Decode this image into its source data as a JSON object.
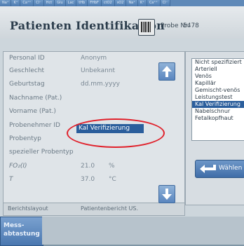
{
  "top_tabs": [
    "Na⁺",
    "K⁺",
    "Ca⁺⁺",
    "Cl⁻",
    "Hct",
    "Glu",
    "Lac",
    "tHb",
    "FHbF",
    "ctO2",
    "sO2",
    "Na⁺",
    "K⁺",
    "Ca⁺⁺",
    "Cl⁻"
  ],
  "header": {
    "title": "Patienten Identifikation",
    "probe_label": "Probe Nr.",
    "probe_value": "5478"
  },
  "fields": [
    {
      "label": "Personal ID",
      "value": "Anonym",
      "unit": ""
    },
    {
      "label": "Geschlecht",
      "value": "Unbekannt",
      "unit": ""
    },
    {
      "label": "Geburtstag",
      "value": "dd.mm.yyyy",
      "unit": ""
    },
    {
      "label": "Nachname (Pat.)",
      "value": "",
      "unit": ""
    },
    {
      "label": "Vorname (Pat.)",
      "value": "",
      "unit": ""
    },
    {
      "label": "Probenehmer ID",
      "value": "",
      "unit": ""
    },
    {
      "label": "Probentyp",
      "value": "",
      "unit": ""
    },
    {
      "label": "spezieller Probentyp",
      "value": "",
      "unit": ""
    },
    {
      "label": "FO₂(I)",
      "value": "21.0",
      "unit": "%"
    },
    {
      "label": "T",
      "value": "37.0",
      "unit": "°C"
    }
  ],
  "probentyp_selected": "Kal Verifizierung",
  "footer": {
    "label": "Berichtslayout",
    "value": "Patientenbericht US."
  },
  "sample_types": {
    "items": [
      "Nicht spezifiziert",
      "Arteriell",
      "Venös",
      "Kapillär",
      "Gemischt-venös",
      "Leistungstest",
      "Kal Verifizierung",
      "Nabelschnur",
      "Fetalkopfhaut"
    ],
    "selected": "Kal Verifizierung"
  },
  "buttons": {
    "waehlen": "Wählen",
    "mess_line1": "Mess-",
    "mess_line2": "abtastung"
  },
  "colors": {
    "selection": "#2b5e9c",
    "annotation": "#e0202a"
  }
}
